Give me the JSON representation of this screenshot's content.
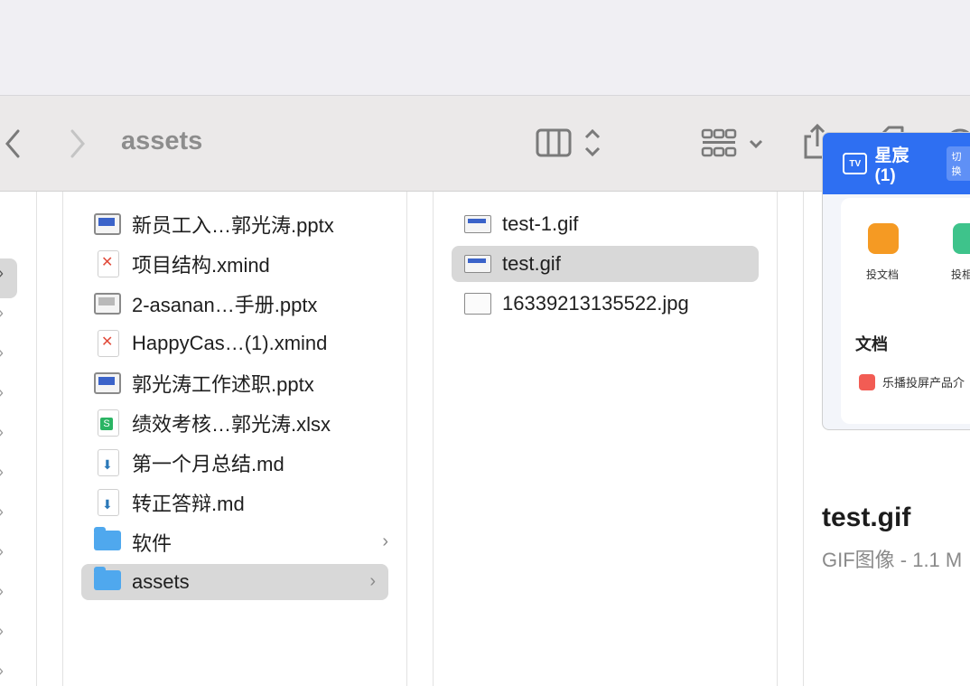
{
  "toolbar": {
    "title": "assets",
    "back_icon": "chevron-left-icon",
    "forward_icon": "chevron-right-icon"
  },
  "column1": {
    "items": [
      {
        "name": "新员工入…郭光涛.pptx",
        "icon": "pptx-icon"
      },
      {
        "name": "项目结构.xmind",
        "icon": "xmind-icon"
      },
      {
        "name": "2-asanan…手册.pptx",
        "icon": "pptx-icon"
      },
      {
        "name": "HappyCas…(1).xmind",
        "icon": "xmind-icon"
      },
      {
        "name": "郭光涛工作述职.pptx",
        "icon": "pptx-icon"
      },
      {
        "name": "绩效考核…郭光涛.xlsx",
        "icon": "xlsx-icon"
      },
      {
        "name": "第一个月总结.md",
        "icon": "md-icon"
      },
      {
        "name": "转正答辩.md",
        "icon": "md-icon"
      },
      {
        "name": "软件",
        "icon": "folder-icon"
      },
      {
        "name": "assets",
        "icon": "folder-icon"
      }
    ]
  },
  "column2": {
    "items": [
      {
        "name": "test-1.gif"
      },
      {
        "name": "test.gif"
      },
      {
        "name": "16339213135522.jpg"
      }
    ]
  },
  "preview": {
    "app_title": "星宸 (1)",
    "badge": "切换",
    "tv_label": "TV",
    "app1": "投文档",
    "app2": "投相",
    "section": "文档",
    "doc_item": "乐播投屏产品介",
    "file_name": "test.gif",
    "file_kind": "GIF图像 - 1.1 M"
  },
  "colors": {
    "selection": "#d8d8d8",
    "folder": "#4fa8ee",
    "preview_header": "#2e6ff2"
  }
}
